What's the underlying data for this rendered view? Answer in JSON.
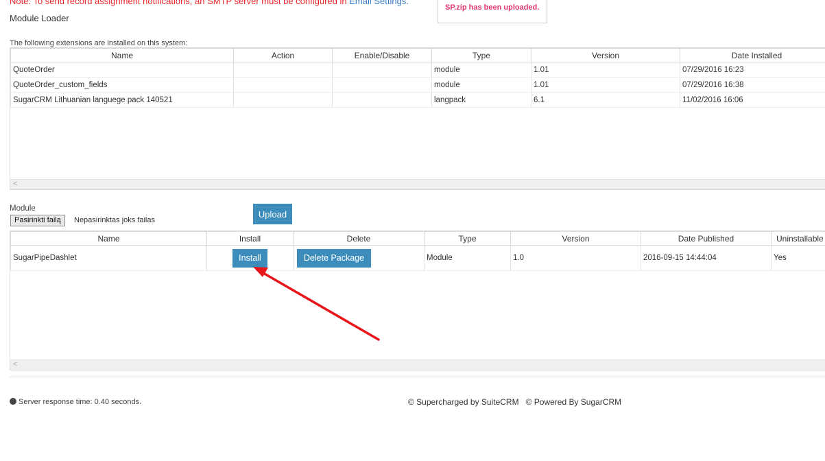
{
  "notice": {
    "text": "Note: To send record assignment notifications, an SMTP server must be configured in ",
    "link": "Email Settings."
  },
  "upload_message": "SP.zip has been uploaded.",
  "page_title": "Module Loader",
  "installed": {
    "label": "The following extensions are installed on this system:",
    "columns": [
      "Name",
      "Action",
      "Enable/Disable",
      "Type",
      "Version",
      "Date Installed"
    ],
    "rows": [
      [
        "QuoteOrder",
        "",
        "",
        "module",
        "1.01",
        "07/29/2016 16:23"
      ],
      [
        "QuoteOrder_custom_fields",
        "",
        "",
        "module",
        "1.01",
        "07/29/2016 16:38"
      ],
      [
        "SugarCRM Lithuanian languege pack 140521",
        "",
        "",
        "langpack",
        "6.1",
        "11/02/2016 16:06"
      ]
    ]
  },
  "upload": {
    "module_label": "Module",
    "choose_file_label": "Pasirinkti failą",
    "no_file_text": "Nepasirinktas joks failas",
    "upload_button": "Upload"
  },
  "packages": {
    "columns": [
      "Name",
      "Install",
      "Delete",
      "Type",
      "Version",
      "Date Published",
      "Uninstallable"
    ],
    "rows": [
      {
        "name": "SugarPipeDashlet",
        "install_label": "Install",
        "delete_label": "Delete Package",
        "type": "Module",
        "version": "1.0",
        "date_published": "2016-09-15 14:44:04",
        "uninstallable": "Yes"
      }
    ]
  },
  "scroll_arrow": "<",
  "footer": {
    "response_time": "Server response time: 0.40 seconds.",
    "credits": "© Supercharged by SuiteCRM   © Powered By SugarCRM"
  },
  "colors": {
    "accent_button": "#3c8dbc",
    "notice_text": "#e8262b",
    "upload_message": "#e0346b",
    "annotation_arrow": "#e8151b"
  }
}
